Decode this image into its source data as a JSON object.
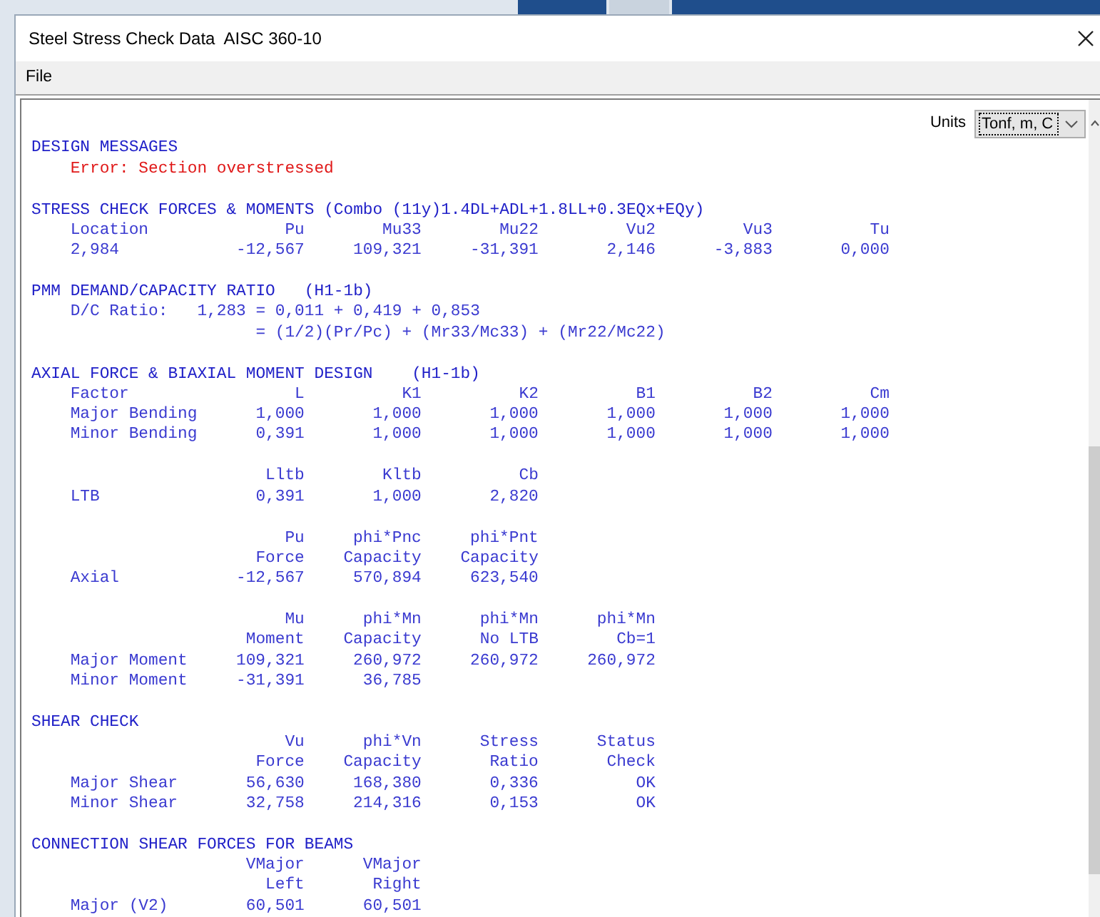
{
  "window": {
    "title": "Steel Stress Check Data  AISC 360-10"
  },
  "menu": [
    {
      "label": "File"
    }
  ],
  "units": {
    "label": "Units",
    "value": "Tonf, m, C"
  },
  "report": [
    {
      "kind": "heading",
      "text": "DESIGN MESSAGES"
    },
    {
      "kind": "error",
      "text": "Error: Section overstressed"
    },
    {
      "kind": "blank"
    },
    {
      "kind": "heading",
      "text": "STRESS CHECK FORCES & MOMENTS (Combo (11y)1.4DL+ADL+1.8LL+0.3EQx+EQy)"
    },
    {
      "kind": "row",
      "label": "Location",
      "cells": [
        "Pu",
        "Mu33",
        "Mu22",
        "Vu2",
        "Vu3",
        "Tu"
      ]
    },
    {
      "kind": "row",
      "label": "2,984",
      "cells": [
        "-12,567",
        "109,321",
        "-31,391",
        "2,146",
        "-3,883",
        "0,000"
      ]
    },
    {
      "kind": "blank"
    },
    {
      "kind": "heading",
      "text": "PMM DEMAND/CAPACITY RATIO   (H1-1b)"
    },
    {
      "kind": "text",
      "text": "D/C Ratio:   1,283 = 0,011 + 0,419 + 0,853"
    },
    {
      "kind": "continuation",
      "text": "= (1/2)(Pr/Pc) + (Mr33/Mc33) + (Mr22/Mc22)"
    },
    {
      "kind": "blank"
    },
    {
      "kind": "heading",
      "text": "AXIAL FORCE & BIAXIAL MOMENT DESIGN    (H1-1b)"
    },
    {
      "kind": "row",
      "label": "Factor",
      "cells": [
        "L",
        "K1",
        "K2",
        "B1",
        "B2",
        "Cm"
      ]
    },
    {
      "kind": "row",
      "label": "Major Bending",
      "cells": [
        "1,000",
        "1,000",
        "1,000",
        "1,000",
        "1,000",
        "1,000"
      ]
    },
    {
      "kind": "row",
      "label": "Minor Bending",
      "cells": [
        "0,391",
        "1,000",
        "1,000",
        "1,000",
        "1,000",
        "1,000"
      ]
    },
    {
      "kind": "blank"
    },
    {
      "kind": "row",
      "cells": [
        "Lltb",
        "Kltb",
        "Cb"
      ]
    },
    {
      "kind": "row",
      "label": "LTB",
      "cells": [
        "0,391",
        "1,000",
        "2,820"
      ]
    },
    {
      "kind": "blank"
    },
    {
      "kind": "row",
      "cells": [
        "Pu",
        "phi*Pnc",
        "phi*Pnt"
      ]
    },
    {
      "kind": "row",
      "cells": [
        "Force",
        "Capacity",
        "Capacity"
      ]
    },
    {
      "kind": "row",
      "label": "Axial",
      "cells": [
        "-12,567",
        "570,894",
        "623,540"
      ]
    },
    {
      "kind": "blank"
    },
    {
      "kind": "row",
      "cells": [
        "Mu",
        "phi*Mn",
        "phi*Mn",
        "phi*Mn"
      ]
    },
    {
      "kind": "row",
      "cells": [
        "Moment",
        "Capacity",
        "No LTB",
        "Cb=1"
      ]
    },
    {
      "kind": "row",
      "label": "Major Moment",
      "cells": [
        "109,321",
        "260,972",
        "260,972",
        "260,972"
      ]
    },
    {
      "kind": "row",
      "label": "Minor Moment",
      "cells": [
        "-31,391",
        "36,785"
      ]
    },
    {
      "kind": "blank"
    },
    {
      "kind": "heading",
      "text": "SHEAR CHECK"
    },
    {
      "kind": "row",
      "cells": [
        "Vu",
        "phi*Vn",
        "Stress",
        "Status"
      ]
    },
    {
      "kind": "row",
      "cells": [
        "Force",
        "Capacity",
        "Ratio",
        "Check"
      ]
    },
    {
      "kind": "row",
      "label": "Major Shear",
      "cells": [
        "56,630",
        "168,380",
        "0,336",
        "OK"
      ]
    },
    {
      "kind": "row",
      "label": "Minor Shear",
      "cells": [
        "32,758",
        "214,316",
        "0,153",
        "OK"
      ]
    },
    {
      "kind": "blank"
    },
    {
      "kind": "heading",
      "text": "CONNECTION SHEAR FORCES FOR BEAMS"
    },
    {
      "kind": "row",
      "cells": [
        "VMajor",
        "VMajor"
      ]
    },
    {
      "kind": "row",
      "cells": [
        "Left",
        "Right"
      ]
    },
    {
      "kind": "row",
      "label": "Major (V2)",
      "cells": [
        "60,501",
        "60,501"
      ]
    }
  ]
}
